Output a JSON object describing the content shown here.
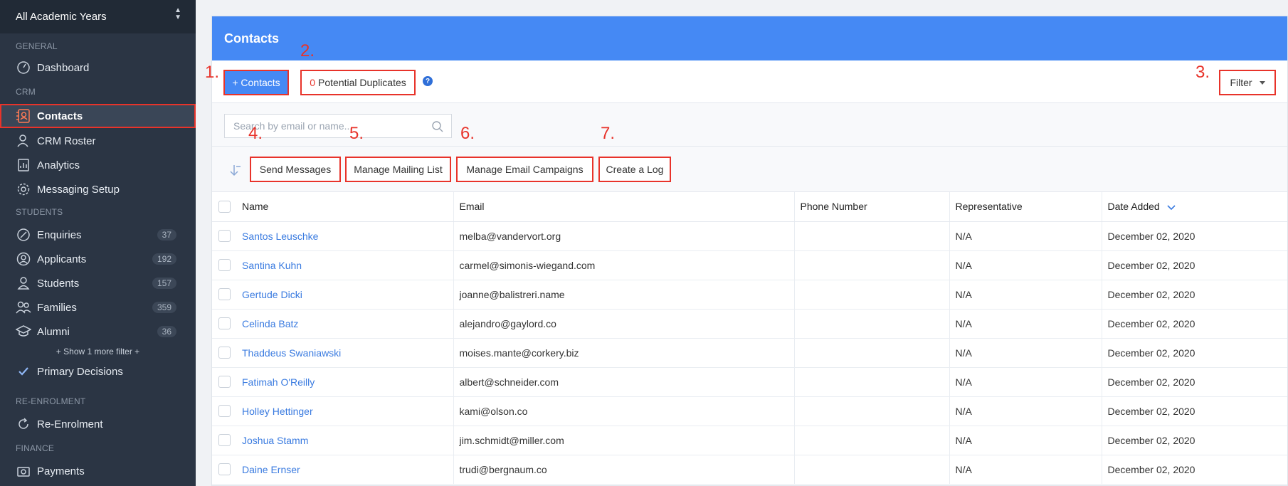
{
  "sidebar": {
    "year_select": "All Academic Years",
    "sections": {
      "general": "GENERAL",
      "crm": "CRM",
      "students": "STUDENTS",
      "reenrolment": "RE-ENROLMENT",
      "finance": "FINANCE"
    },
    "items": {
      "dashboard": {
        "label": "Dashboard",
        "icon": "dashboard-icon"
      },
      "contacts": {
        "label": "Contacts",
        "icon": "contacts-icon"
      },
      "crm_roster": {
        "label": "CRM Roster",
        "icon": "roster-icon"
      },
      "analytics": {
        "label": "Analytics",
        "icon": "analytics-icon"
      },
      "messaging_setup": {
        "label": "Messaging Setup",
        "icon": "gear-icon"
      },
      "enquiries": {
        "label": "Enquiries",
        "count": "37",
        "icon": "pencil-icon"
      },
      "applicants": {
        "label": "Applicants",
        "count": "192",
        "icon": "person-circle-icon"
      },
      "students": {
        "label": "Students",
        "count": "157",
        "icon": "person-icon"
      },
      "families": {
        "label": "Families",
        "count": "359",
        "icon": "family-icon"
      },
      "alumni": {
        "label": "Alumni",
        "count": "36",
        "icon": "graduation-cap-icon"
      },
      "show_more": "+ Show 1 more filter +",
      "primary_decisions": {
        "label": "Primary Decisions",
        "icon": "check-icon"
      },
      "reenrolment": {
        "label": "Re-Enrolment",
        "icon": "refresh-icon"
      },
      "payments": {
        "label": "Payments",
        "icon": "payments-icon"
      }
    }
  },
  "main": {
    "title": "Contacts",
    "add_contacts": "+ Contacts",
    "duplicates_count": "0",
    "duplicates_label": "Potential Duplicates",
    "help": "?",
    "filter": "Filter",
    "search_placeholder": "Search by email or name...",
    "actions": {
      "send": "Send Messages",
      "mailing": "Manage Mailing List",
      "campaigns": "Manage Email Campaigns",
      "log": "Create a Log"
    },
    "annotations": [
      "1.",
      "2.",
      "3.",
      "4.",
      "5.",
      "6.",
      "7."
    ],
    "columns": [
      "Name",
      "Email",
      "Phone Number",
      "Representative",
      "Date Added"
    ],
    "rows": [
      {
        "name": "Santos Leuschke",
        "email": "melba@vandervort.org",
        "phone": "",
        "rep": "N/A",
        "date": "December 02, 2020"
      },
      {
        "name": "Santina Kuhn",
        "email": "carmel@simonis-wiegand.com",
        "phone": "",
        "rep": "N/A",
        "date": "December 02, 2020"
      },
      {
        "name": "Gertude Dicki",
        "email": "joanne@balistreri.name",
        "phone": "",
        "rep": "N/A",
        "date": "December 02, 2020"
      },
      {
        "name": "Celinda Batz",
        "email": "alejandro@gaylord.co",
        "phone": "",
        "rep": "N/A",
        "date": "December 02, 2020"
      },
      {
        "name": "Thaddeus Swaniawski",
        "email": "moises.mante@corkery.biz",
        "phone": "",
        "rep": "N/A",
        "date": "December 02, 2020"
      },
      {
        "name": "Fatimah O'Reilly",
        "email": "albert@schneider.com",
        "phone": "",
        "rep": "N/A",
        "date": "December 02, 2020"
      },
      {
        "name": "Holley Hettinger",
        "email": "kami@olson.co",
        "phone": "",
        "rep": "N/A",
        "date": "December 02, 2020"
      },
      {
        "name": "Joshua Stamm",
        "email": "jim.schmidt@miller.com",
        "phone": "",
        "rep": "N/A",
        "date": "December 02, 2020"
      },
      {
        "name": "Daine Ernser",
        "email": "trudi@bergnaum.co",
        "phone": "",
        "rep": "N/A",
        "date": "December 02, 2020"
      }
    ]
  },
  "colors": {
    "accent": "#4589f4",
    "sidebar": "#2b3544",
    "annotation": "#e8332a",
    "link": "#3a7be0"
  }
}
